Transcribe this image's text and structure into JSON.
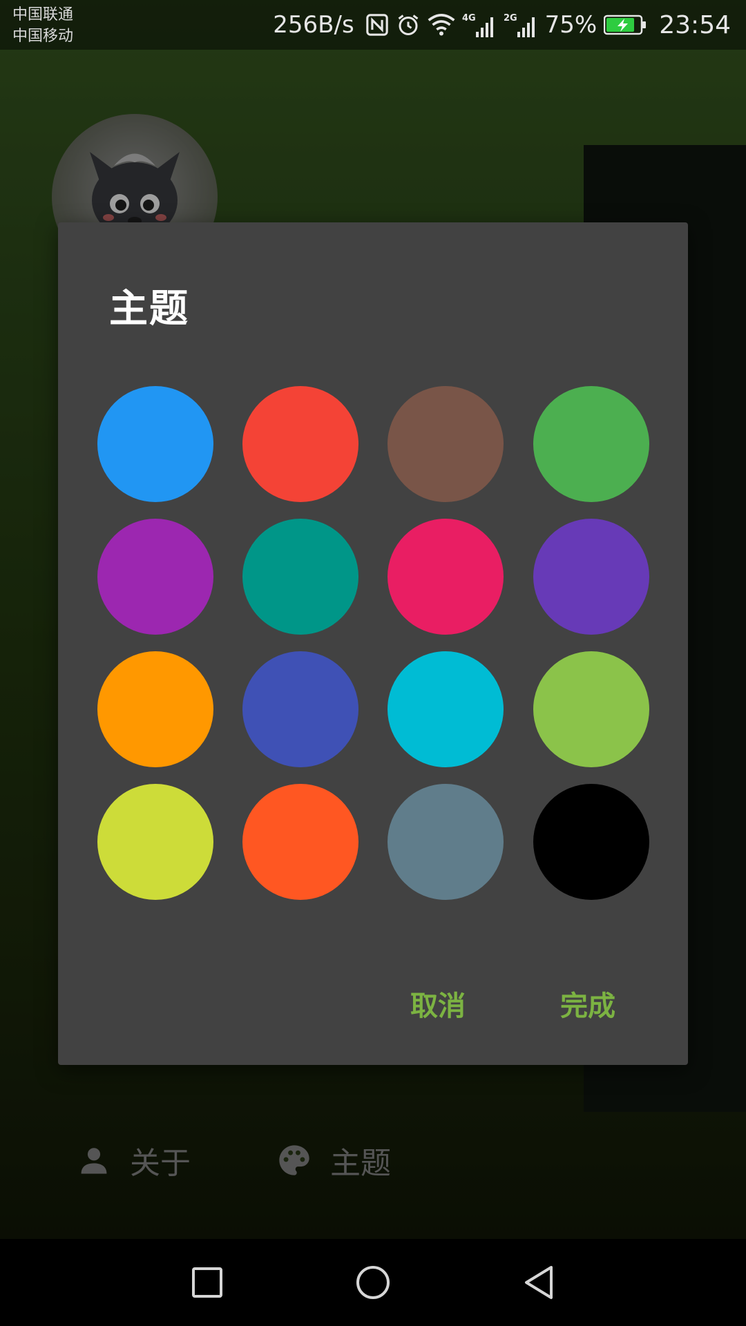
{
  "status_bar": {
    "carrier_1": "中国联通",
    "carrier_2": "中国移动",
    "net_speed": "256B/s",
    "network_1": "4G",
    "network_2": "2G",
    "battery_percent": "75%",
    "time": "23:54",
    "icons": [
      "nfc-icon",
      "alarm-icon",
      "wifi-icon",
      "signal-4g-icon",
      "signal-2g-icon",
      "battery-charging-icon"
    ]
  },
  "background_menu": {
    "about_label": "关于",
    "theme_label": "主题",
    "icons": [
      "person-icon",
      "palette-icon"
    ]
  },
  "dialog": {
    "title": "主题",
    "colors": [
      "#2196F3",
      "#F44336",
      "#795548",
      "#4CAF50",
      "#9C27B0",
      "#009688",
      "#E91E63",
      "#673AB7",
      "#FF9800",
      "#3F51B5",
      "#00BCD4",
      "#8BC34A",
      "#CDDC39",
      "#FF5722",
      "#607D8B",
      "#000000"
    ],
    "cancel_label": "取消",
    "confirm_label": "完成",
    "accent_color": "#7CB342"
  },
  "nav_bar": {
    "icons": [
      "recent-apps-icon",
      "home-icon",
      "back-icon"
    ]
  }
}
